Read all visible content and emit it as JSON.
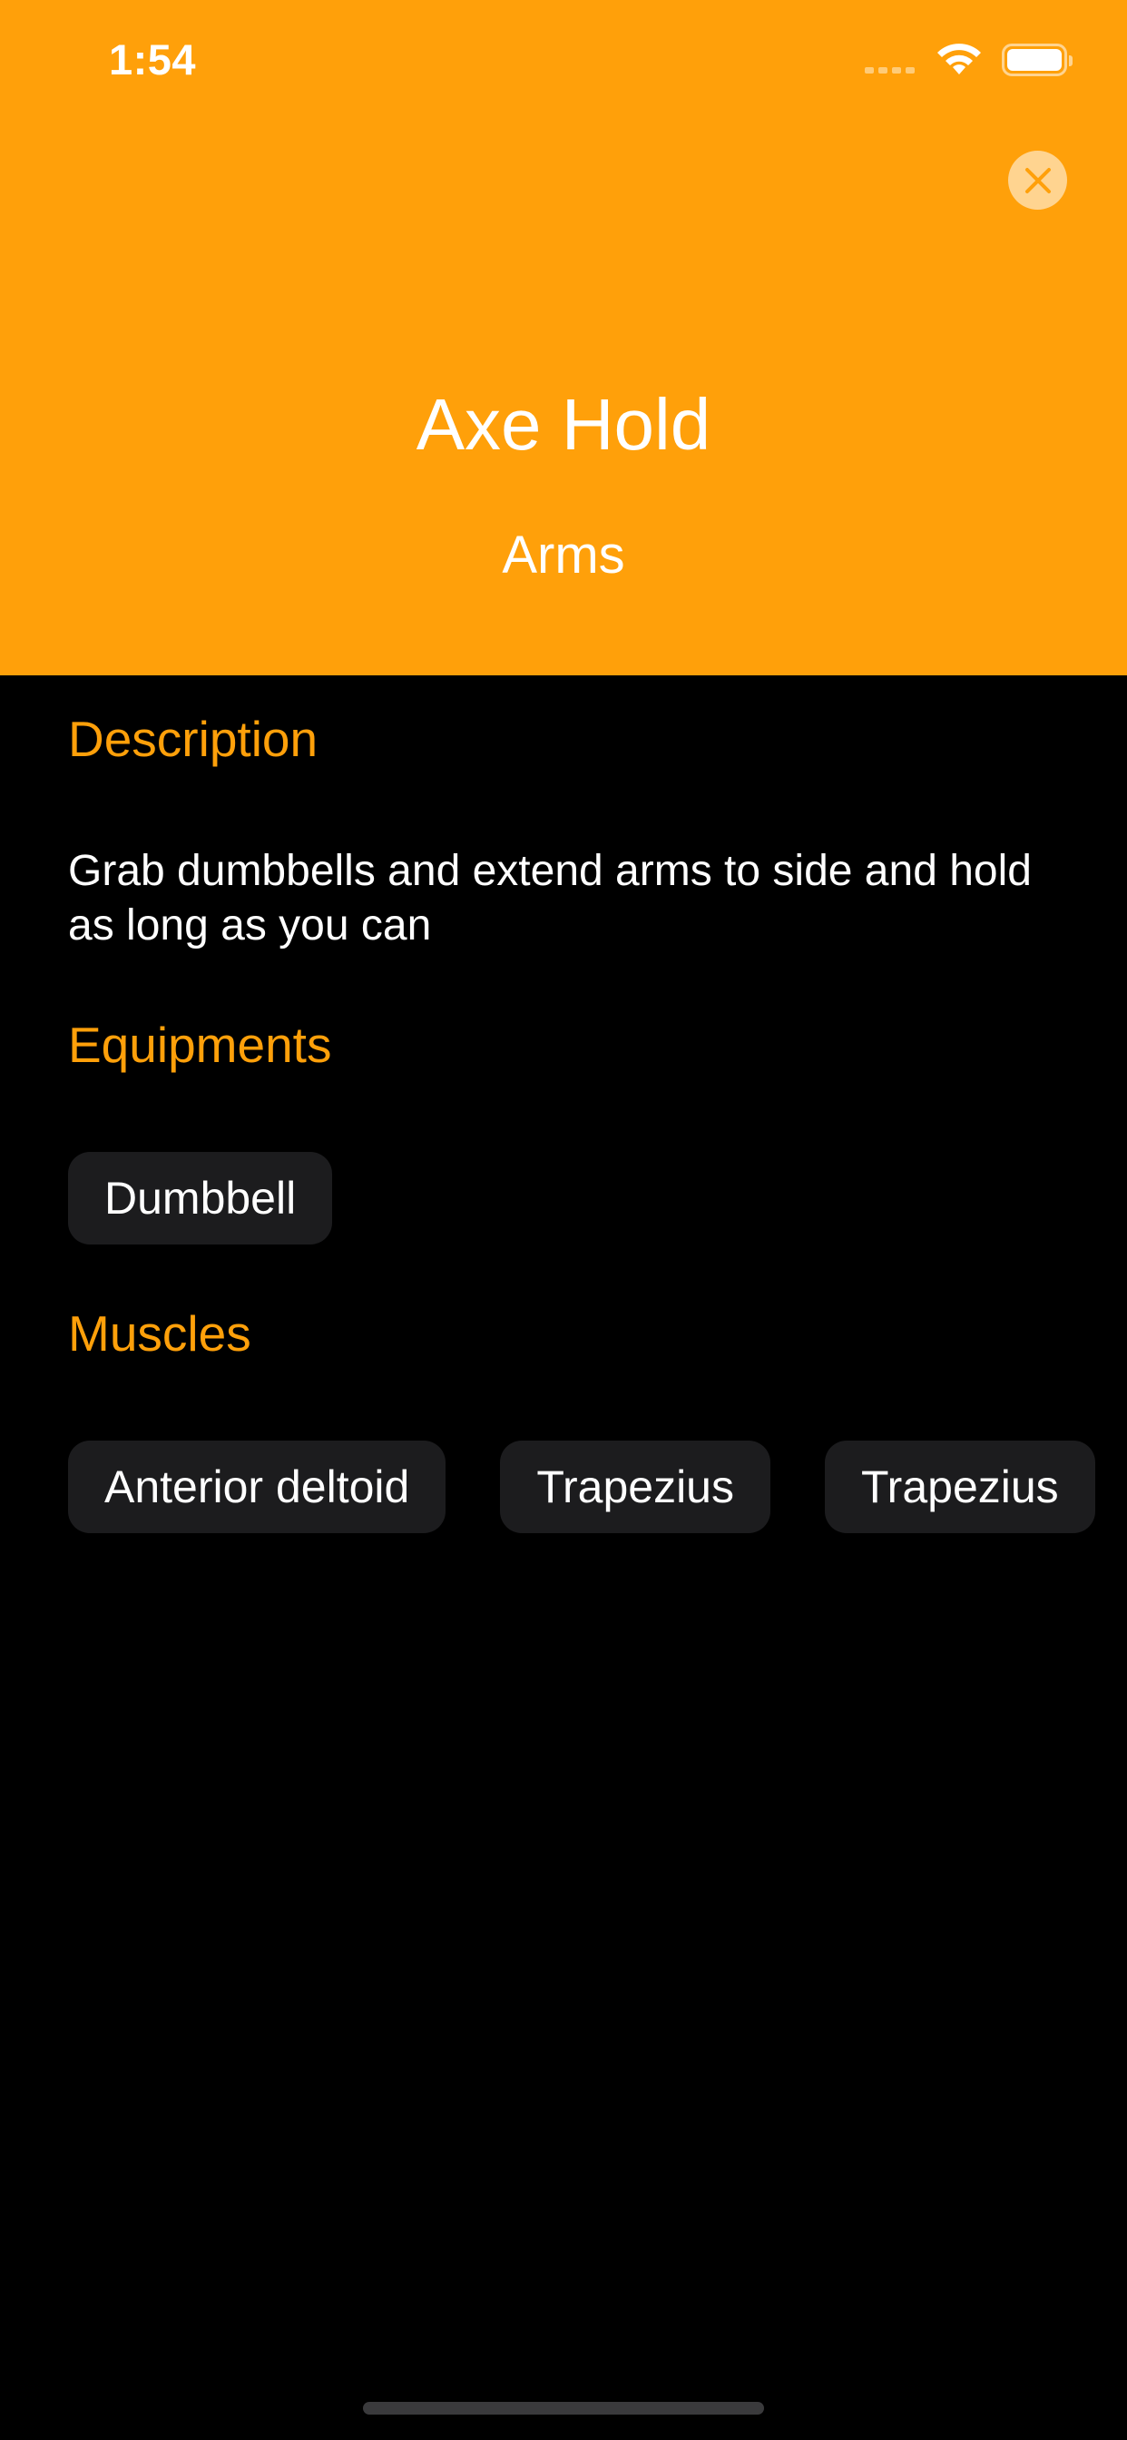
{
  "status_bar": {
    "time": "1:54"
  },
  "header": {
    "background_color": "#FFA00A",
    "title": "Axe Hold",
    "subtitle": "Arms",
    "close_icon": "close-icon"
  },
  "sections": {
    "description": {
      "heading": "Description",
      "text": "Grab dumbbells and extend arms to side and hold as long as you can"
    },
    "equipments": {
      "heading": "Equipments",
      "items": [
        "Dumbbell"
      ]
    },
    "muscles": {
      "heading": "Muscles",
      "items": [
        "Anterior deltoid",
        "Trapezius",
        "Trapezius"
      ]
    }
  },
  "colors": {
    "accent": "#FFA00A",
    "background": "#000000",
    "chip_background": "#1C1C1E",
    "text": "#FFFFFF"
  }
}
